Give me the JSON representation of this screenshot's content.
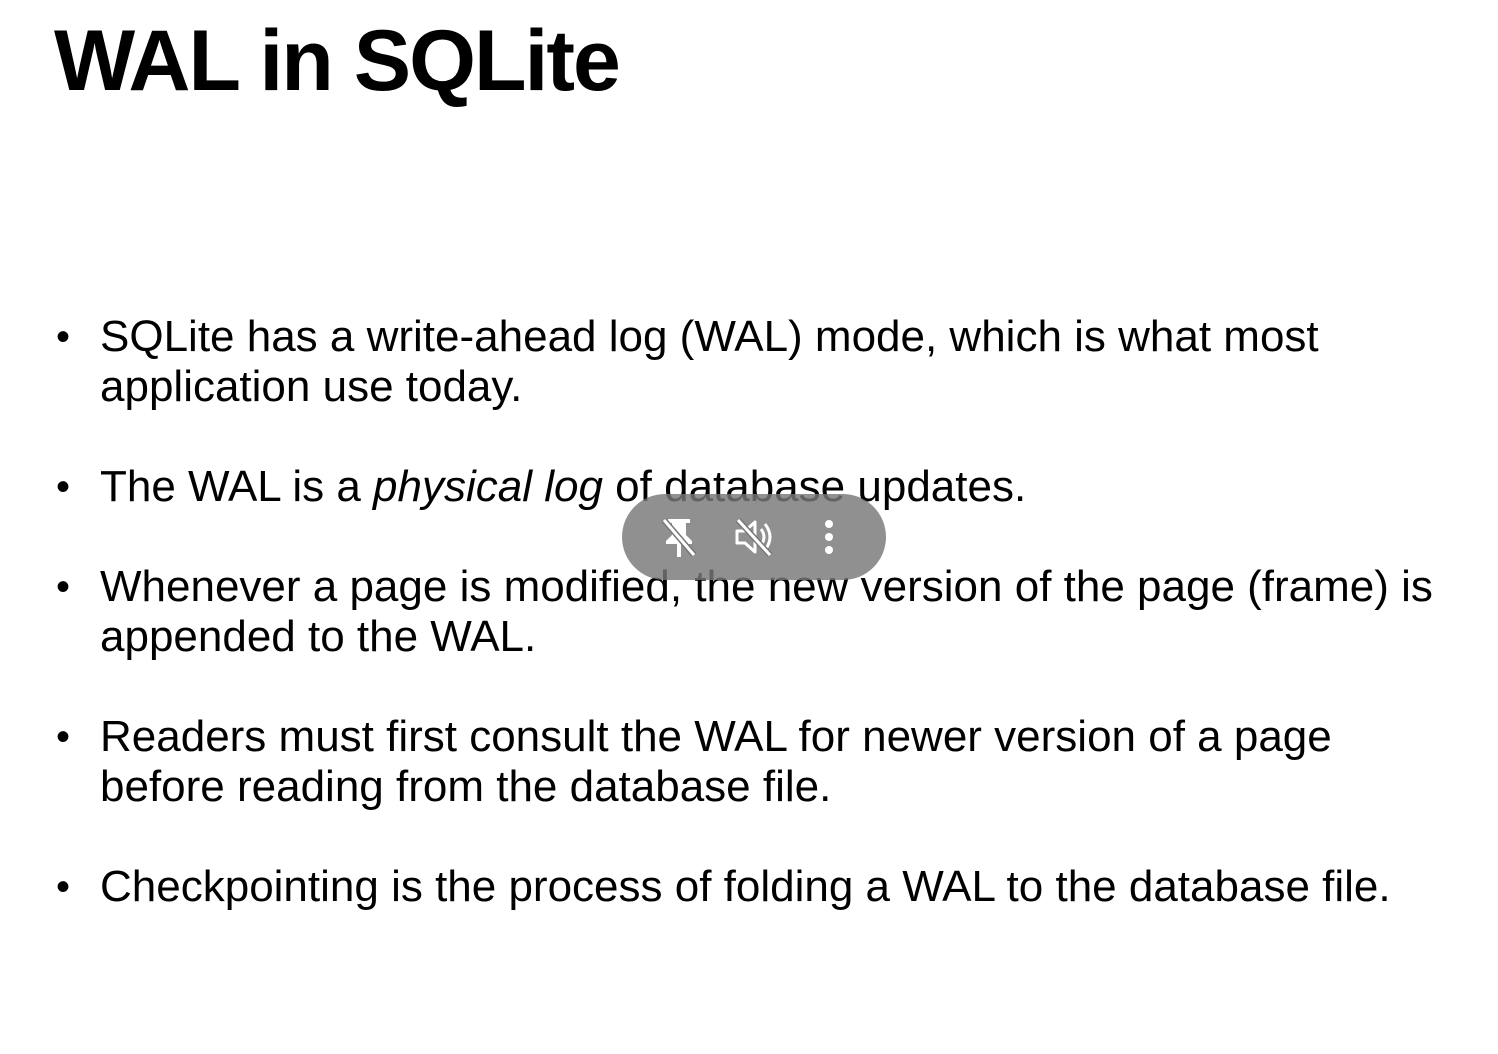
{
  "slide": {
    "title": "WAL in SQLite",
    "bullets": [
      {
        "before": "SQLite has a write-ahead log (WAL) mode, which is what most application use today.",
        "emphasis": "",
        "after": ""
      },
      {
        "before": "The WAL is a ",
        "emphasis": "physical log",
        "after": " of database updates."
      },
      {
        "before": "Whenever a page is modified, the new version of the page (frame) is appended to the WAL.",
        "emphasis": "",
        "after": ""
      },
      {
        "before": "Readers must first consult the WAL for newer version of a page before reading from the database file.",
        "emphasis": "",
        "after": ""
      },
      {
        "before": "Checkpointing is the process of folding a WAL to the database file.",
        "emphasis": "",
        "after": ""
      }
    ],
    "bullet_glyph": "•"
  },
  "video_controls": {
    "icons": [
      "unpin-icon",
      "mute-icon",
      "more-vert-icon"
    ],
    "pill_color": "#787878",
    "icon_color": "#ffffff"
  }
}
